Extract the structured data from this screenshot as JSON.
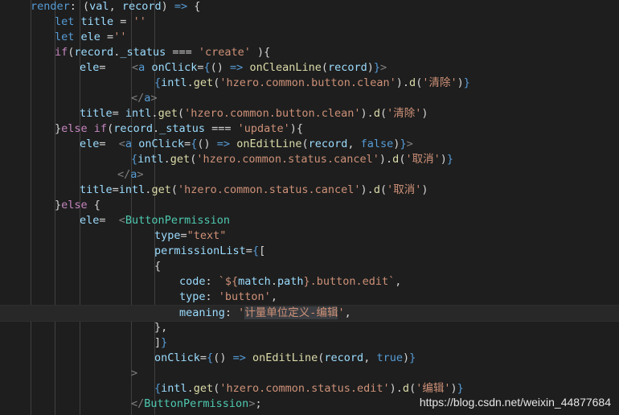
{
  "editor": {
    "lines": [
      [
        [
          "kw",
          "render"
        ],
        [
          "plain",
          ": ("
        ],
        [
          "var",
          "val"
        ],
        [
          "plain",
          ", "
        ],
        [
          "var",
          "record"
        ],
        [
          "plain",
          ") "
        ],
        [
          "kw",
          "=>"
        ],
        [
          "plain",
          " {"
        ]
      ],
      [
        [
          "kw",
          "let"
        ],
        [
          "plain",
          " "
        ],
        [
          "var",
          "title"
        ],
        [
          "plain",
          " = "
        ],
        [
          "str",
          "''"
        ]
      ],
      [
        [
          "kw",
          "let"
        ],
        [
          "plain",
          " "
        ],
        [
          "var",
          "ele"
        ],
        [
          "plain",
          " ="
        ],
        [
          "str",
          "''"
        ]
      ],
      [
        [
          "ctl",
          "if"
        ],
        [
          "plain",
          "("
        ],
        [
          "var",
          "record"
        ],
        [
          "plain",
          "."
        ],
        [
          "var",
          "_status"
        ],
        [
          "plain",
          " === "
        ],
        [
          "str",
          "'create'"
        ],
        [
          "plain",
          " ){"
        ]
      ],
      [
        [
          "var",
          "ele"
        ],
        [
          "plain",
          "=    "
        ],
        [
          "punc",
          "<"
        ],
        [
          "tag",
          "a"
        ],
        [
          "plain",
          " "
        ],
        [
          "var",
          "onClick"
        ],
        [
          "plain",
          "="
        ],
        [
          "kw",
          "{"
        ],
        [
          "plain",
          "() "
        ],
        [
          "kw",
          "=>"
        ],
        [
          "plain",
          " "
        ],
        [
          "fn",
          "onCleanLine"
        ],
        [
          "plain",
          "("
        ],
        [
          "var",
          "record"
        ],
        [
          "plain",
          ")"
        ],
        [
          "kw",
          "}"
        ],
        [
          "punc",
          ">"
        ]
      ],
      [
        [
          "kw",
          "{"
        ],
        [
          "var",
          "intl"
        ],
        [
          "plain",
          "."
        ],
        [
          "fn",
          "get"
        ],
        [
          "plain",
          "("
        ],
        [
          "str",
          "'hzero.common.button.clean'"
        ],
        [
          "plain",
          ")."
        ],
        [
          "fn",
          "d"
        ],
        [
          "plain",
          "("
        ],
        [
          "str",
          "'清除'"
        ],
        [
          "plain",
          ")"
        ],
        [
          "kw",
          "}"
        ]
      ],
      [
        [
          "punc",
          "</"
        ],
        [
          "tag",
          "a"
        ],
        [
          "punc",
          ">"
        ]
      ],
      [
        [
          "var",
          "title"
        ],
        [
          "plain",
          "= "
        ],
        [
          "var",
          "intl"
        ],
        [
          "plain",
          "."
        ],
        [
          "fn",
          "get"
        ],
        [
          "plain",
          "("
        ],
        [
          "str",
          "'hzero.common.button.clean'"
        ],
        [
          "plain",
          ")."
        ],
        [
          "fn",
          "d"
        ],
        [
          "plain",
          "("
        ],
        [
          "str",
          "'清除'"
        ],
        [
          "plain",
          ")"
        ]
      ],
      [
        [
          "plain",
          "}"
        ],
        [
          "ctl",
          "else"
        ],
        [
          "plain",
          " "
        ],
        [
          "ctl",
          "if"
        ],
        [
          "plain",
          "("
        ],
        [
          "var",
          "record"
        ],
        [
          "plain",
          "."
        ],
        [
          "var",
          "_status"
        ],
        [
          "plain",
          " === "
        ],
        [
          "str",
          "'update'"
        ],
        [
          "plain",
          "){"
        ]
      ],
      [
        [
          "var",
          "ele"
        ],
        [
          "plain",
          "=  "
        ],
        [
          "punc",
          "<"
        ],
        [
          "tag",
          "a"
        ],
        [
          "plain",
          " "
        ],
        [
          "var",
          "onClick"
        ],
        [
          "plain",
          "="
        ],
        [
          "kw",
          "{"
        ],
        [
          "plain",
          "() "
        ],
        [
          "kw",
          "=>"
        ],
        [
          "plain",
          " "
        ],
        [
          "fn",
          "onEditLine"
        ],
        [
          "plain",
          "("
        ],
        [
          "var",
          "record"
        ],
        [
          "plain",
          ", "
        ],
        [
          "kw",
          "false"
        ],
        [
          "plain",
          ")"
        ],
        [
          "kw",
          "}"
        ],
        [
          "punc",
          ">"
        ]
      ],
      [
        [
          "kw",
          "{"
        ],
        [
          "var",
          "intl"
        ],
        [
          "plain",
          "."
        ],
        [
          "fn",
          "get"
        ],
        [
          "plain",
          "("
        ],
        [
          "str",
          "'hzero.common.status.cancel'"
        ],
        [
          "plain",
          ")."
        ],
        [
          "fn",
          "d"
        ],
        [
          "plain",
          "("
        ],
        [
          "str",
          "'取消'"
        ],
        [
          "plain",
          ")"
        ],
        [
          "kw",
          "}"
        ]
      ],
      [
        [
          "punc",
          "</"
        ],
        [
          "tag",
          "a"
        ],
        [
          "punc",
          ">"
        ]
      ],
      [
        [
          "var",
          "title"
        ],
        [
          "plain",
          "="
        ],
        [
          "var",
          "intl"
        ],
        [
          "plain",
          "."
        ],
        [
          "fn",
          "get"
        ],
        [
          "plain",
          "("
        ],
        [
          "str",
          "'hzero.common.status.cancel'"
        ],
        [
          "plain",
          ")."
        ],
        [
          "fn",
          "d"
        ],
        [
          "plain",
          "("
        ],
        [
          "str",
          "'取消'"
        ],
        [
          "plain",
          ")"
        ]
      ],
      [
        [
          "plain",
          "}"
        ],
        [
          "ctl",
          "else"
        ],
        [
          "plain",
          " {"
        ]
      ],
      [
        [
          "var",
          "ele"
        ],
        [
          "plain",
          "=  "
        ],
        [
          "punc",
          "<"
        ],
        [
          "comp",
          "ButtonPermission"
        ]
      ],
      [
        [
          "var",
          "type"
        ],
        [
          "plain",
          "="
        ],
        [
          "str",
          "\"text\""
        ]
      ],
      [
        [
          "var",
          "permissionList"
        ],
        [
          "plain",
          "="
        ],
        [
          "kw",
          "{"
        ],
        [
          "plain",
          "["
        ]
      ],
      [
        [
          "plain",
          "{"
        ]
      ],
      [
        [
          "var",
          "code"
        ],
        [
          "plain",
          ": "
        ],
        [
          "str",
          "`${"
        ],
        [
          "var",
          "match"
        ],
        [
          "plain",
          "."
        ],
        [
          "var",
          "path"
        ],
        [
          "str",
          "}.button.edit`"
        ],
        [
          "plain",
          ","
        ]
      ],
      [
        [
          "var",
          "type"
        ],
        [
          "plain",
          ": "
        ],
        [
          "str",
          "'button'"
        ],
        [
          "plain",
          ","
        ]
      ],
      [
        [
          "var",
          "meaning"
        ],
        [
          "plain",
          ": "
        ],
        [
          "str",
          "'"
        ],
        [
          "sstr",
          "计量单位定义-编辑"
        ],
        [
          "str",
          "'"
        ],
        [
          "plain",
          ","
        ]
      ],
      [
        [
          "plain",
          "},"
        ]
      ],
      [
        [
          "plain",
          "]"
        ],
        [
          "kw",
          "}"
        ]
      ],
      [
        [
          "var",
          "onClick"
        ],
        [
          "plain",
          "="
        ],
        [
          "kw",
          "{"
        ],
        [
          "plain",
          "() "
        ],
        [
          "kw",
          "=>"
        ],
        [
          "plain",
          " "
        ],
        [
          "fn",
          "onEditLine"
        ],
        [
          "plain",
          "("
        ],
        [
          "var",
          "record"
        ],
        [
          "plain",
          ", "
        ],
        [
          "kw",
          "true"
        ],
        [
          "plain",
          ")"
        ],
        [
          "kw",
          "}"
        ]
      ],
      [
        [
          "punc",
          ">"
        ]
      ],
      [
        [
          "kw",
          "{"
        ],
        [
          "var",
          "intl"
        ],
        [
          "plain",
          "."
        ],
        [
          "fn",
          "get"
        ],
        [
          "plain",
          "("
        ],
        [
          "str",
          "'hzero.common.status.edit'"
        ],
        [
          "plain",
          ")."
        ],
        [
          "fn",
          "d"
        ],
        [
          "plain",
          "("
        ],
        [
          "str",
          "'编辑'"
        ],
        [
          "plain",
          ")"
        ],
        [
          "kw",
          "}"
        ]
      ],
      [
        [
          "punc",
          "</"
        ],
        [
          "comp",
          "ButtonPermission"
        ],
        [
          "punc",
          ">"
        ],
        [
          "plain",
          ";"
        ]
      ]
    ]
  },
  "watermark": "https://blog.csdn.net/weixin_44877684"
}
